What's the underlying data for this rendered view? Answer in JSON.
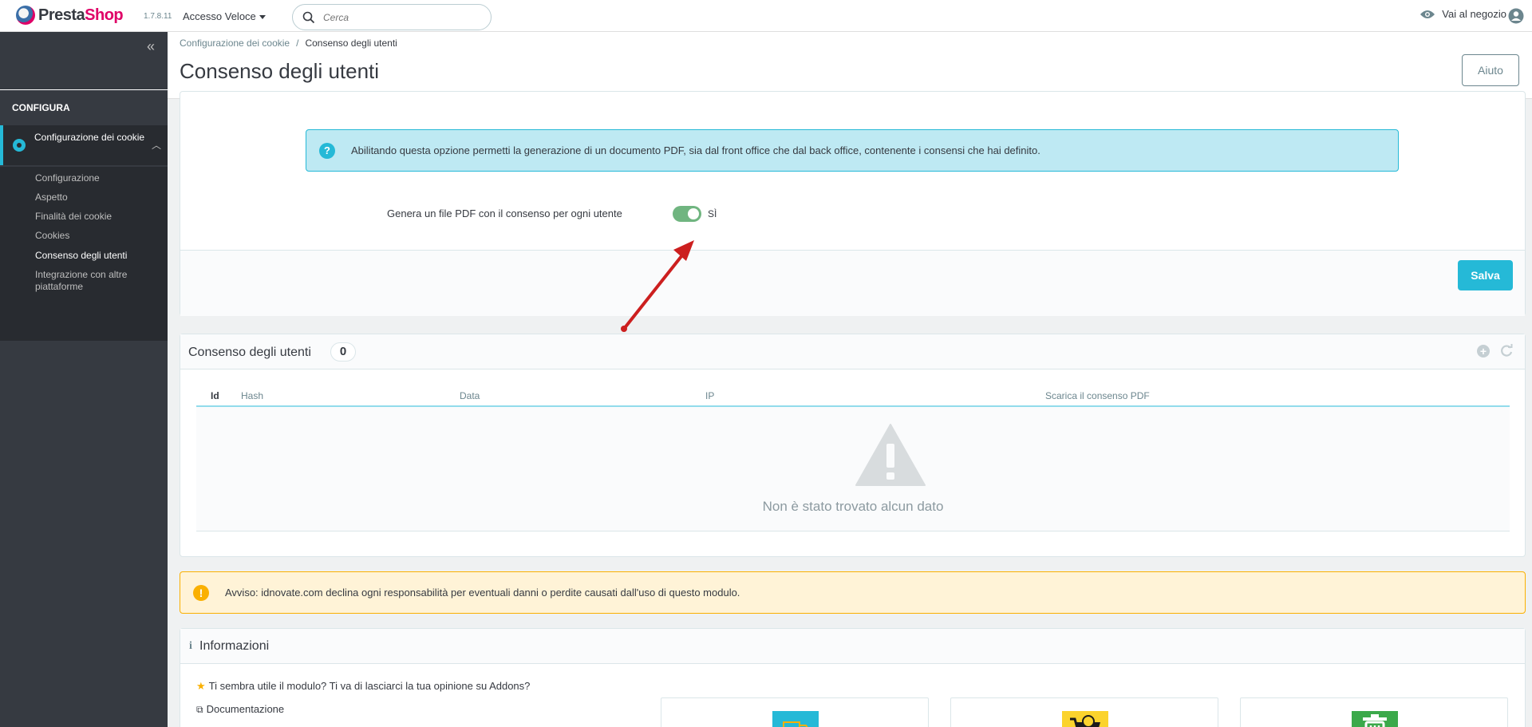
{
  "header": {
    "logo_prefix": "Presta",
    "logo_suffix": "Shop",
    "version": "1.7.8.11",
    "quick_access": "Accesso Veloce",
    "search_placeholder": "Cerca",
    "view_shop": "Vai al negozio"
  },
  "sidebar": {
    "collapse": "«",
    "section": "CONFIGURA",
    "active_item": "Configurazione dei cookie",
    "sub_items": [
      "Configurazione",
      "Aspetto",
      "Finalità dei cookie",
      "Cookies",
      "Consenso degli utenti",
      "Integrazione con altre piattaforme"
    ]
  },
  "page": {
    "breadcrumb": [
      "Configurazione dei cookie",
      "Consenso degli utenti"
    ],
    "title": "Consenso degli utenti",
    "help": "Aiuto"
  },
  "config": {
    "info_text": "Abilitando questa opzione permetti la generazione di un documento PDF, sia dal front office che dal back office, contenente i consensi che hai definito.",
    "pdf_label": "Genera un file PDF con il consenso per ogni utente",
    "pdf_enabled": true,
    "toggle_text": "SÌ",
    "save": "Salva"
  },
  "table": {
    "title": "Consenso degli utenti",
    "count": "0",
    "columns": [
      "Id",
      "Hash",
      "Data",
      "IP",
      "Scarica il consenso PDF"
    ],
    "rows": [],
    "empty_text": "Non è stato trovato alcun dato"
  },
  "warning": {
    "text": "Avviso: idnovate.com declina ogni responsabilità per eventuali danni o perdite causati dall'uso di questo modulo."
  },
  "info": {
    "title": "Informazioni",
    "rate_link": "Ti sembra utile il modulo? Ti va di lasciarci la tua opinione su Addons?",
    "docs_link": "Documentazione"
  },
  "colors": {
    "accent": "#25b9d7",
    "brand": "#df0067",
    "success": "#70b580",
    "warning": "#fab000",
    "arrow": "#cc1f1f"
  }
}
